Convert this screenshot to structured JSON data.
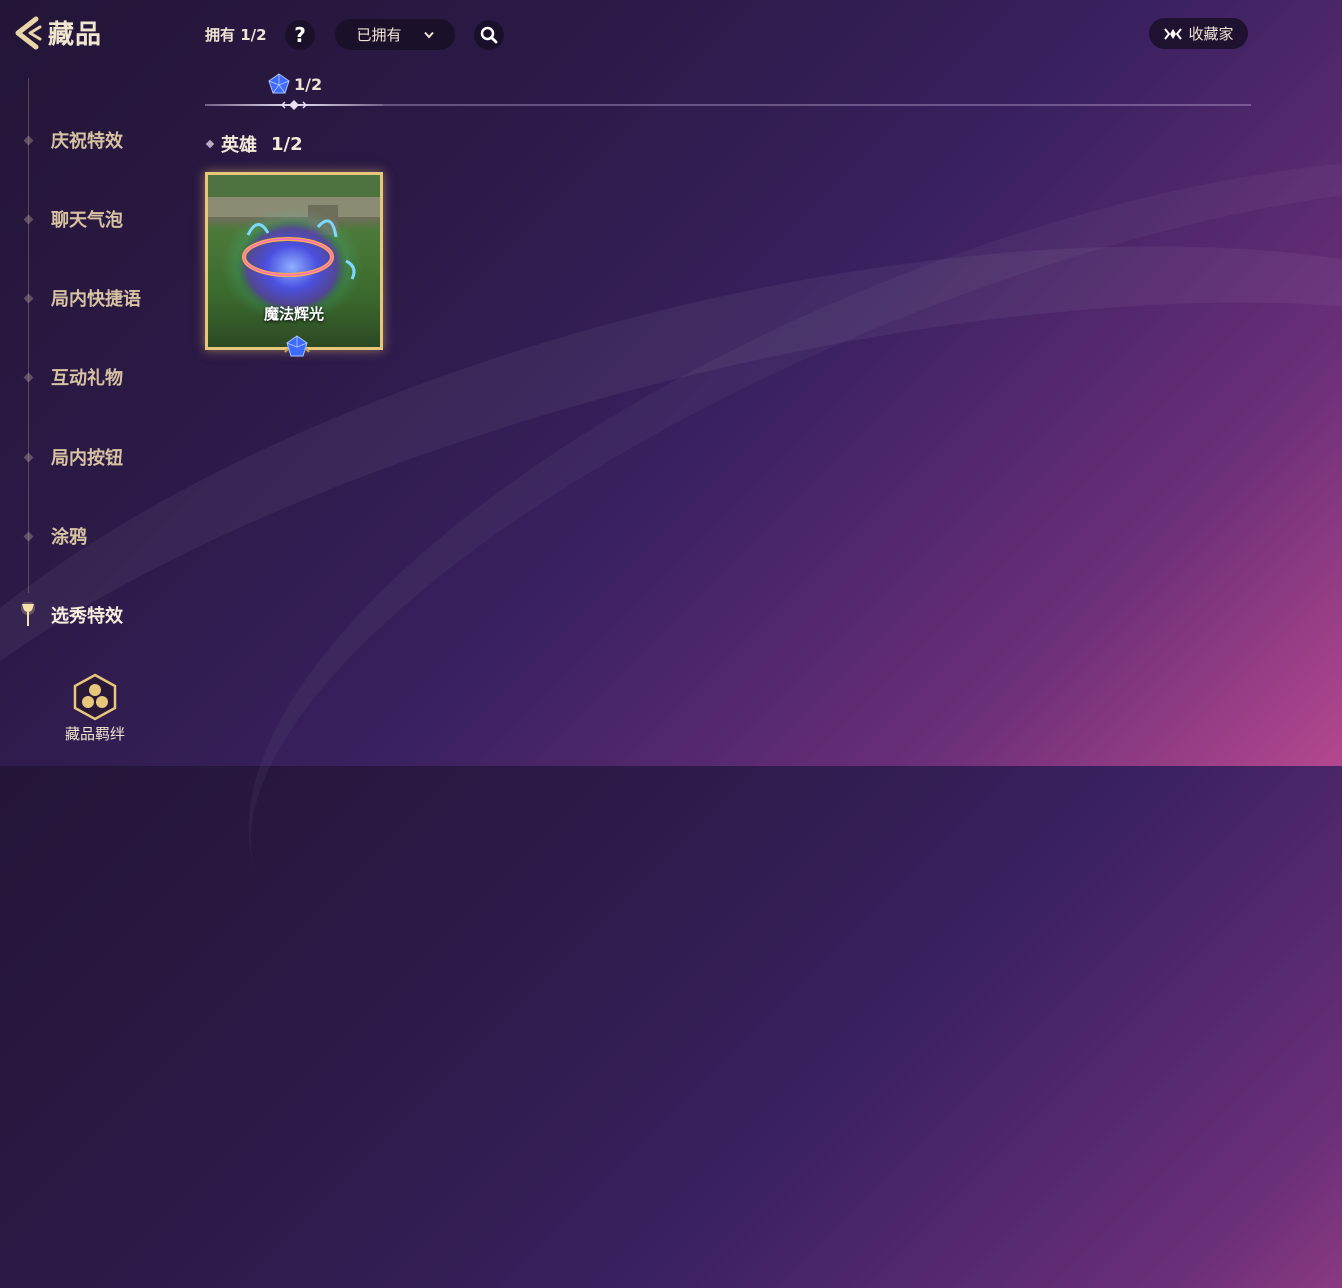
{
  "header": {
    "title": "藏品",
    "owned_text": "拥有 1/2",
    "help_label": "?",
    "filter_selected": "已拥有",
    "collector_label": "收藏家"
  },
  "sidebar": {
    "items": [
      {
        "label": "庆祝特效",
        "active": false
      },
      {
        "label": "聊天气泡",
        "active": false
      },
      {
        "label": "局内快捷语",
        "active": false
      },
      {
        "label": "互动礼物",
        "active": false
      },
      {
        "label": "局内按钮",
        "active": false
      },
      {
        "label": "涂鸦",
        "active": false
      },
      {
        "label": "选秀特效",
        "active": true
      }
    ],
    "bonds_label": "藏品羁绊"
  },
  "tier": {
    "count": "1/2"
  },
  "section": {
    "label": "英雄",
    "count": "1/2"
  },
  "items": [
    {
      "name": "魔法辉光",
      "rarity_icon": "blue-gem-icon"
    }
  ],
  "colors": {
    "accent_gold": "#e6c77b",
    "text_gold": "#d7c2a2",
    "gem_blue": "#3d6bff"
  }
}
